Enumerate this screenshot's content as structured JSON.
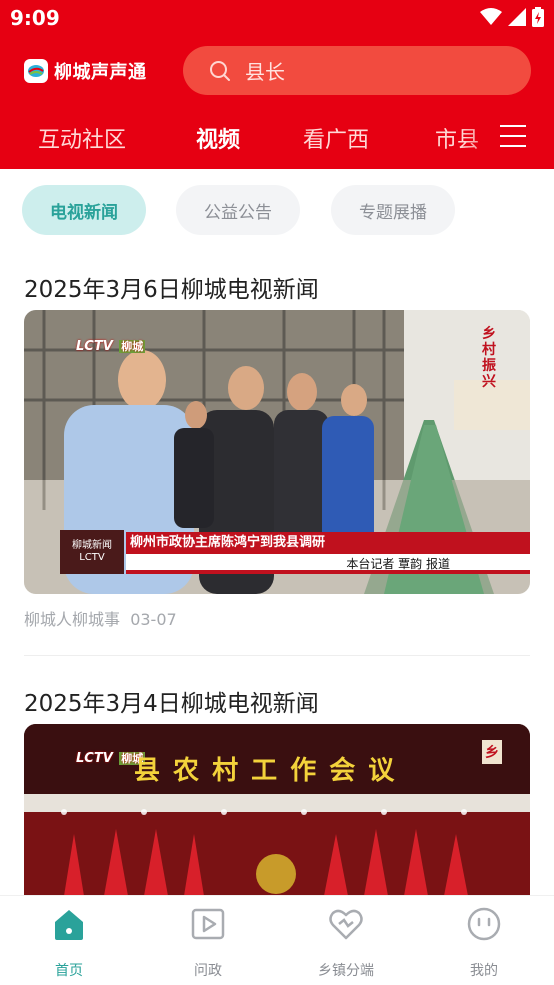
{
  "status": {
    "time": "9:09"
  },
  "colors": {
    "brand_red": "#e60012",
    "accent_teal": "#2aa29a"
  },
  "app": {
    "name": "柳城声声通"
  },
  "search": {
    "placeholder": "县长"
  },
  "nav_tabs": [
    {
      "label": "互动社区",
      "active": false
    },
    {
      "label": "视频",
      "active": true
    },
    {
      "label": "看广西",
      "active": false
    },
    {
      "label": "市县",
      "active": false
    }
  ],
  "chips": [
    {
      "label": "电视新闻",
      "active": true
    },
    {
      "label": "公益公告",
      "active": false
    },
    {
      "label": "专题展播",
      "active": false
    }
  ],
  "articles": [
    {
      "title": "2025年3月6日柳城电视新闻",
      "source": "柳城人柳城事",
      "date": "03-07",
      "overlay": {
        "channel_logo": "LCTV",
        "channel_sub": "柳城",
        "corner_tag": "乡村振兴",
        "caption_logo": "柳城新闻",
        "caption_logo_sub": "LCTV",
        "headline": "柳州市政协主席陈鸿宁到我县调研",
        "reporter": "本台记者  覃韵  报道"
      }
    },
    {
      "title": "2025年3月4日柳城电视新闻",
      "overlay": {
        "channel_logo": "LCTV",
        "channel_sub": "柳城",
        "banner": "县 农 村 工 作 会 议",
        "corner_tag": "乡"
      }
    }
  ],
  "bottom_nav": [
    {
      "label": "首页",
      "icon": "home-icon",
      "active": true
    },
    {
      "label": "问政",
      "icon": "play-square-icon",
      "active": false
    },
    {
      "label": "乡镇分端",
      "icon": "heart-link-icon",
      "active": false
    },
    {
      "label": "我的",
      "icon": "smiley-icon",
      "active": false
    }
  ]
}
